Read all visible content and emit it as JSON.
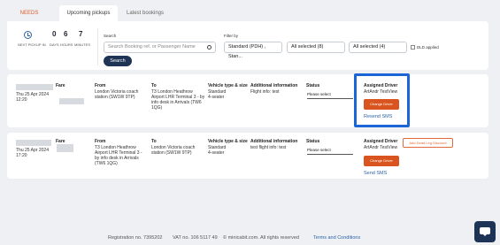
{
  "tabs": {
    "attention": "NEEDS ATTENTION",
    "upcoming": "Upcoming pickups",
    "latest": "Latest bookings"
  },
  "next_pickup": {
    "label": "NEXT PICKUP IN",
    "days": "0",
    "days_label": "DAYS",
    "hours": "6",
    "hours_label": "HOURS",
    "minutes": "7",
    "minutes_label": "MINUTES"
  },
  "search": {
    "label": "Search",
    "placeholder": "Search Booking ref. or Passenger Name",
    "button": "Search"
  },
  "filter": {
    "label": "Filter by",
    "type": "Standard (PDH) , Stan...",
    "sel1": "All selected (8)",
    "sel2": "All selected (4)",
    "dld": "DLD applied"
  },
  "headers": {
    "fare": "Fare",
    "from": "From",
    "to": "To",
    "vehicle": "Vehicle type & size",
    "info": "Additional information",
    "status": "Status",
    "assigned": "Assigned Driver"
  },
  "bookings": [
    {
      "date": "Thu 25 Apr 2024",
      "time": "12:20",
      "from": "London Victoria coach station (SW1W 9TP)",
      "to": "T3 London Heathrow Airport LHR Terminal 3 - by info desk in Arrivals (TW6 1QG)",
      "vehicle": "Standard",
      "seats": "4-seater",
      "info": "Flight info: test",
      "status": "Please select",
      "driver": "ArtAndr TestView",
      "change": "Change Driver",
      "action": "Resend SMS"
    },
    {
      "date": "Thu 25 Apr 2024",
      "time": "17:20",
      "from": "T3 London Heathrow Airport LHR Terminal 3 - by info desk in Arrivals (TW6 1QG)",
      "to": "London Victoria coach station (SW1W 9TP)",
      "vehicle": "Standard",
      "seats": "4-seater",
      "info": "test flight info: test",
      "status": "Please select",
      "driver": "ArtAndr TestView",
      "change": "Change Driver",
      "action": "Send SMS",
      "discount": "Add Dead Leg Discount"
    }
  ],
  "footer": {
    "reg": "Registration no. 7395202",
    "vat": "VAT no. 106 5117 49",
    "copy": "© minicabit.com. All rights reserved",
    "terms": "Terms and Conditions"
  }
}
